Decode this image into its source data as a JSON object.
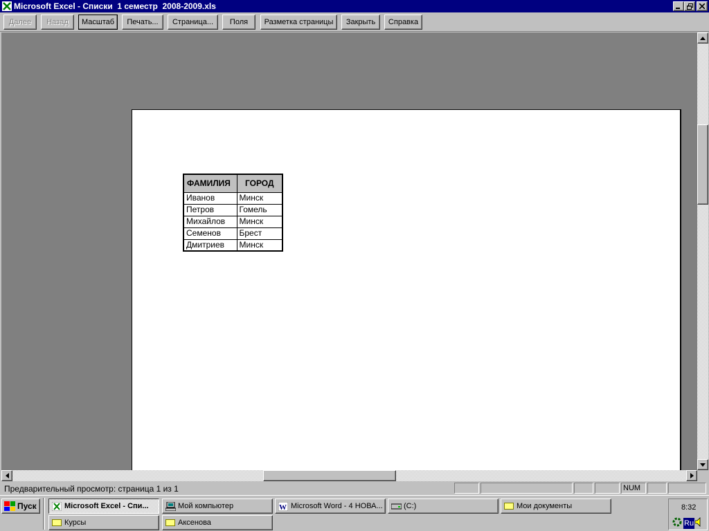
{
  "window": {
    "title": "Microsoft Excel - Списки  1 семестр  2008-2009.xls",
    "controls": {
      "minimize": "minimize-icon",
      "restore": "restore-icon",
      "close": "close-icon"
    }
  },
  "toolbar": {
    "next": "Далее",
    "prev": "Назад",
    "zoom": "Масштаб",
    "print": "Печать...",
    "setup": "Страница...",
    "margins": "Поля",
    "page_break": "Разметка страницы",
    "close": "Закрыть",
    "help": "Справка"
  },
  "sheet": {
    "headers": [
      "ФАМИЛИЯ",
      "ГОРОД"
    ],
    "rows": [
      [
        "Иванов",
        "Минск"
      ],
      [
        "Петров",
        "Гомель"
      ],
      [
        "Михайлов",
        "Минск"
      ],
      [
        "Семенов",
        "Брест"
      ],
      [
        "Дмитриев",
        "Минск"
      ]
    ]
  },
  "statusbar": {
    "text": "Предварительный просмотр: страница 1 из 1",
    "num": "NUM"
  },
  "taskbar": {
    "start": "Пуск",
    "tasks": [
      "Microsoft Excel - Спи...",
      "Мой компьютер",
      "Microsoft Word - 4 НОВА...",
      "(C:)",
      "Мои документы",
      "Курсы",
      "Аксенова"
    ],
    "clock": "8:32",
    "language": "Ru"
  },
  "colors": {
    "titlebar": "#000080",
    "face": "#c0c0c0",
    "preview_bg": "#808080"
  }
}
